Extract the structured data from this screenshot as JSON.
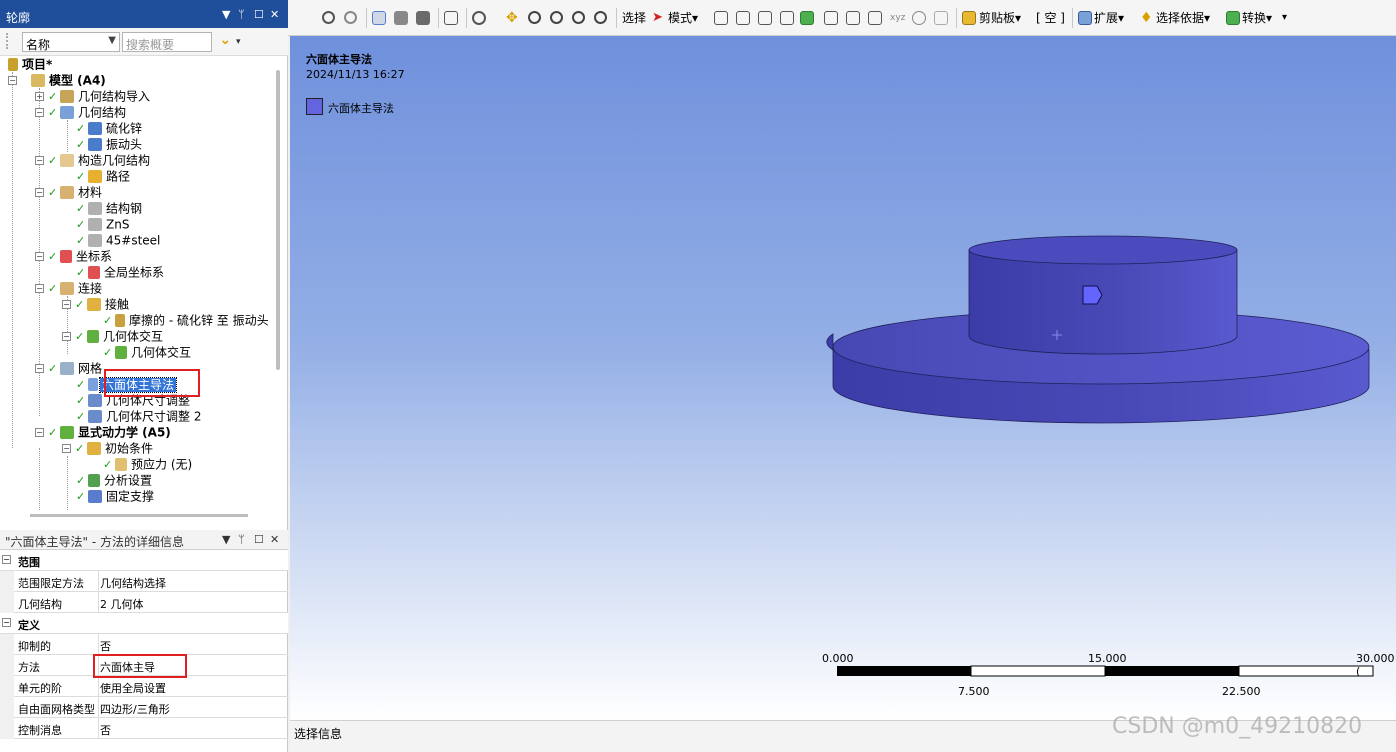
{
  "outline": {
    "title": "轮廓",
    "filter_select": "名称",
    "search_placeholder": "搜索概要",
    "tree": [
      {
        "label": "项目*",
        "bold": true
      },
      {
        "label": "模型 (A4)",
        "bold": true
      },
      {
        "label": "几何结构导入"
      },
      {
        "label": "几何结构"
      },
      {
        "label": "硫化锌"
      },
      {
        "label": "振动头"
      },
      {
        "label": "构造几何结构"
      },
      {
        "label": "路径"
      },
      {
        "label": "材料"
      },
      {
        "label": "结构钢"
      },
      {
        "label": "ZnS"
      },
      {
        "label": "45#steel"
      },
      {
        "label": "坐标系"
      },
      {
        "label": "全局坐标系"
      },
      {
        "label": "连接"
      },
      {
        "label": "接触"
      },
      {
        "label": "摩擦的 - 硫化锌 至 振动头"
      },
      {
        "label": "几何体交互"
      },
      {
        "label": "几何体交互"
      },
      {
        "label": "网格"
      },
      {
        "label": "六面体主导法",
        "selected": true
      },
      {
        "label": "几何体尺寸调整"
      },
      {
        "label": "几何体尺寸调整 2"
      },
      {
        "label": "显式动力学 (A5)",
        "bold": true
      },
      {
        "label": "初始条件"
      },
      {
        "label": "预应力 (无)"
      },
      {
        "label": "分析设置"
      },
      {
        "label": "固定支撑"
      }
    ]
  },
  "details": {
    "title": "\"六面体主导法\" - 方法的详细信息",
    "rows": [
      {
        "key": "范围",
        "category": true
      },
      {
        "key": "范围限定方法",
        "value": "几何结构选择"
      },
      {
        "key": "几何结构",
        "value": "2 几何体"
      },
      {
        "key": "定义",
        "category": true
      },
      {
        "key": "抑制的",
        "value": "否"
      },
      {
        "key": "方法",
        "value": "六面体主导"
      },
      {
        "key": "单元的阶",
        "value": "使用全局设置"
      },
      {
        "key": "自由面网格类型",
        "value": "四边形/三角形"
      },
      {
        "key": "控制消息",
        "value": "否"
      }
    ]
  },
  "toolbar": {
    "select": "选择",
    "mode": "模式",
    "clipboard": "剪贴板",
    "empty": "[ 空 ]",
    "extend": "扩展",
    "select_by": "选择依据",
    "convert": "转换"
  },
  "viewport": {
    "title": "六面体主导法",
    "date": "2024/11/13 16:27",
    "legend": "六面体主导法",
    "scale_top": [
      "0.000",
      "15.000",
      "30.000 ("
    ],
    "scale_bottom": [
      "7.500",
      "22.500"
    ]
  },
  "bottom": {
    "selection_info": "选择信息"
  },
  "watermark": "CSDN @m0_49210820",
  "colors": {
    "title_bar": "#1f4f9a",
    "body_color": "#5050c8",
    "selection": "#3375d7",
    "highlight_box": "#e02020"
  }
}
